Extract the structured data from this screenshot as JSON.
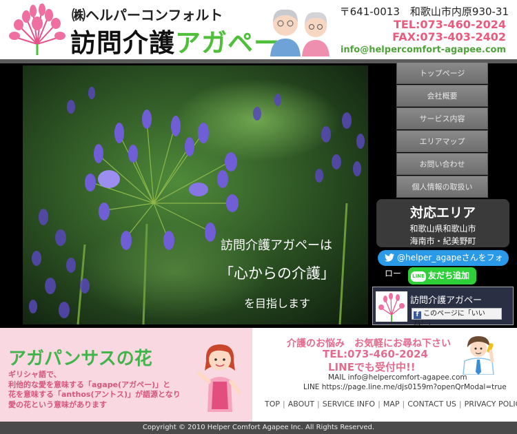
{
  "header": {
    "company_small": "㈱ヘルパーコンフォルト",
    "company_main": "訪問介護",
    "company_accent": "アガペー",
    "address": "〒641-0013　和歌山市内原930-31",
    "tel": "TEL:073-460-2024",
    "fax": "FAX:073-403-2402",
    "email": "info@helpercomfort-agapee.com"
  },
  "nav": {
    "items": [
      {
        "label": "トップページ"
      },
      {
        "label": "会社概要"
      },
      {
        "label": "サービス内容"
      },
      {
        "label": "エリアマップ"
      },
      {
        "label": "お問い合わせ"
      },
      {
        "label": "個人情報の取扱い"
      }
    ]
  },
  "hero": {
    "line1": "訪問介護アガペーは",
    "line2": "「心からの介護」",
    "line3": "を目指します"
  },
  "area": {
    "title": "対応エリア",
    "line1": "和歌山県和歌山市",
    "line2": "海南市・紀美野町"
  },
  "social": {
    "twitter_label": "@helper_agapeさんをフォロー",
    "line_label": "友だち追加",
    "line_logo": "LINE",
    "fb_page_name": "訪問介護アガペー",
    "fb_like_label": "このページに「いいね！」"
  },
  "agapanthus": {
    "title": "アガパンサスの花",
    "desc_lines": [
      "ギリシャ語で、",
      "利他的な愛を意味する「agape(アガペー)」と",
      "花を意味する「anthos(アントス)」が語源となり",
      "愛の花という意味があります"
    ]
  },
  "contact": {
    "heading": "介護のお悩み　お気軽にお尋ね下さい",
    "tel": "TEL:073-460-2024",
    "line_ok": "LINEでも受付中!!",
    "mail": "MAIL info@helpercomfort-agapee.com",
    "line_url": "LINE https://page.line.me/djs0159m?openQrModal=true"
  },
  "footer": {
    "links": [
      {
        "label": "TOP"
      },
      {
        "label": "ABOUT"
      },
      {
        "label": "SERVICE INFO"
      },
      {
        "label": "MAP"
      },
      {
        "label": "CONTACT US"
      },
      {
        "label": "PRIVACY POLICY"
      }
    ],
    "copyright": "Copyright © 2010 Helper Comfort Agapee Inc. All Rights Reserved."
  },
  "colors": {
    "pink": "#ea5a7d",
    "green": "#4fbf3a",
    "nav_gray": "#7a7a7a",
    "twitter_blue": "#2a9ae8",
    "line_green": "#2fcf3a"
  }
}
